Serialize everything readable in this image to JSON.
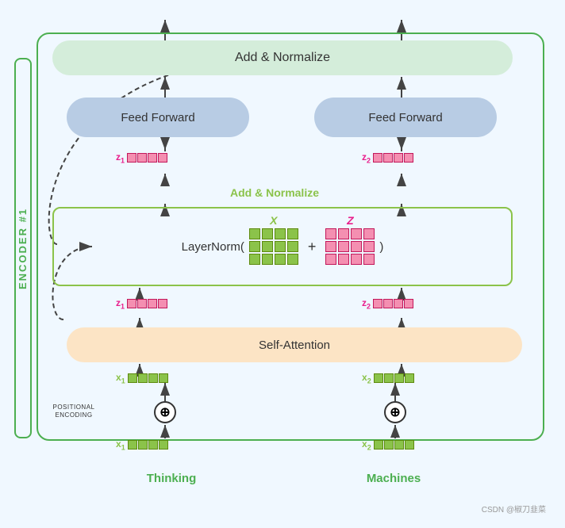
{
  "encoder": {
    "label": "ENCODER #1"
  },
  "add_norm_top": {
    "label": "Add & Normalize"
  },
  "feed_forward_left": {
    "label": "Feed Forward"
  },
  "feed_forward_right": {
    "label": "Feed Forward"
  },
  "add_norm_mid": {
    "label": "Add & Normalize"
  },
  "layer_norm": {
    "prefix": "LayerNorm(",
    "plus": "+",
    "suffix": ")",
    "x_label": "X",
    "z_label": "Z"
  },
  "self_attention": {
    "label": "Self-Attention"
  },
  "positional_encoding": {
    "label": "POSITIONAL ENCODING",
    "symbol": "⊕"
  },
  "words": {
    "left": "Thinking",
    "right": "Machines"
  },
  "tokens": {
    "z1_label": "z",
    "z1_sub": "1",
    "z2_label": "z",
    "z2_sub": "2",
    "x1_label": "x",
    "x1_sub": "1",
    "x2_label": "x",
    "x2_sub": "2"
  },
  "watermark": "CSDN @椒刀韭菜"
}
